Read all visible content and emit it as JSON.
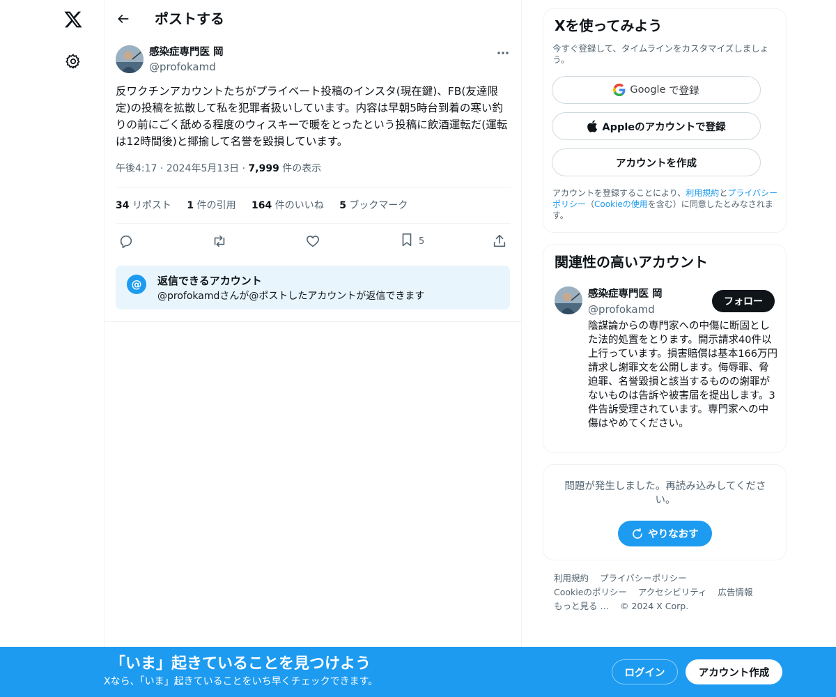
{
  "page": {
    "title": "ポストする"
  },
  "nav": {
    "logo_icon": "x-logo-icon",
    "settings_icon": "gear-icon"
  },
  "tweet": {
    "author_name": "感染症専門医 岡",
    "author_handle": "@profokamd",
    "text": "反ワクチンアカウントたちがプライベート投稿のインスタ(現在鍵)、FB(友達限定)の投稿を拡散して私を犯罪者扱いしています。内容は早朝5時台到着の寒い釣りの前にごく舐める程度のウィスキーで暖をとったという投稿に飲酒運転だ(運転は12時間後)と揶揄して名誉を毀損しています。",
    "time": "午後4:17",
    "date": "2024年5月13日",
    "views_count": "7,999",
    "views_label": "件の表示",
    "stats": {
      "retweets_count": "34",
      "retweets_label": "リポスト",
      "quotes_count": "1",
      "quotes_label": "件の引用",
      "likes_count": "164",
      "likes_label": "件のいいね",
      "bookmarks_count": "5",
      "bookmarks_label": "ブックマーク"
    },
    "actions": {
      "bookmark_count": "5"
    },
    "reply_restriction": {
      "title": "返信できるアカウント",
      "description": "@profokamdさんが@ポストしたアカウントが返信できます"
    }
  },
  "signup_card": {
    "title": "Xを使ってみよう",
    "subtitle": "今すぐ登録して、タイムラインをカスタマイズしましょう。",
    "google_brand": "Google",
    "google_suffix": " で登録",
    "apple_label": "Appleのアカウントで登録",
    "create_label": "アカウントを作成",
    "terms_prefix": "アカウントを登録することにより、",
    "terms_link": "利用規約",
    "terms_and": "と",
    "privacy_link": "プライバシーポリシー",
    "cookie_open": "（",
    "cookie_link": "Cookieの使用",
    "terms_suffix": "を含む）に同意したとみなされます。"
  },
  "related": {
    "title": "関連性の高いアカウント",
    "name": "感染症専門医 岡",
    "handle": "@profokamd",
    "follow_label": "フォロー",
    "bio": "陰謀論からの専門家への中傷に断固とした法的処置をとります。開示請求40件以上行っています。損害賠償は基本166万円請求し謝罪文を公開します。侮辱罪、脅迫罪、名誉毀損と該当するものの謝罪がないものは告訴や被害届を提出します。3件告訴受理されています。専門家への中傷はやめてください。"
  },
  "error_card": {
    "message": "問題が発生しました。再読み込みしてください。",
    "retry_label": "やりなおす"
  },
  "footer": {
    "terms": "利用規約",
    "privacy": "プライバシーポリシー",
    "cookie": "Cookieのポリシー",
    "accessibility": "アクセシビリティ",
    "ads": "広告情報",
    "more": "もっと見る …",
    "copyright": "© 2024 X Corp."
  },
  "bottom_bar": {
    "title": "「いま」起きていることを見つけよう",
    "subtitle": "Xなら、「いま」起きていることをいち早くチェックできます。",
    "login_label": "ログイン",
    "signup_label": "アカウント作成"
  },
  "colors": {
    "accent": "#1d9bf0",
    "text": "#0f1419",
    "muted": "#536471",
    "border": "#eff3f4"
  }
}
